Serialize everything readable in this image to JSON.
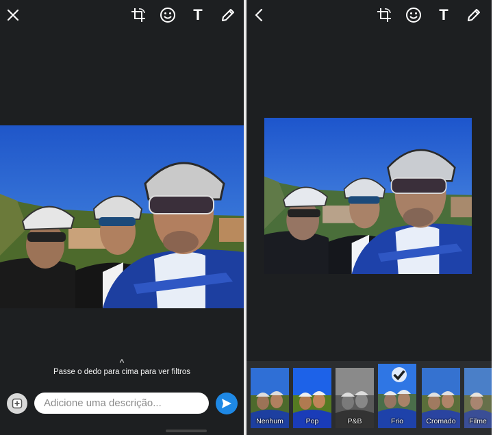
{
  "left_panel": {
    "toolbar": {
      "close_icon": "close-icon",
      "tools": [
        "crop-rotate-icon",
        "emoji-icon",
        "text-tool-icon",
        "pencil-icon"
      ],
      "text_tool_label": "T"
    },
    "swipe_hint": "Passe o dedo para cima para ver filtros",
    "caption_placeholder": "Adicione uma descrição...",
    "add_icon": "add-media-icon",
    "send_icon": "send-icon"
  },
  "right_panel": {
    "toolbar": {
      "back_icon": "back-chevron-icon",
      "tools": [
        "crop-rotate-icon",
        "emoji-icon",
        "text-tool-icon",
        "pencil-icon"
      ],
      "text_tool_label": "T"
    },
    "filters": [
      {
        "label": "Nenhum",
        "tone": "normal"
      },
      {
        "label": "Pop",
        "tone": "pop"
      },
      {
        "label": "P&B",
        "tone": "bw"
      },
      {
        "label": "Frio",
        "tone": "cool",
        "selected": true
      },
      {
        "label": "Cromado",
        "tone": "chrome"
      },
      {
        "label": "Filme",
        "tone": "film"
      }
    ]
  },
  "colors": {
    "background": "#1d1f21",
    "send_button": "#1e88e5",
    "filter_strip": "#2b2d2f"
  }
}
